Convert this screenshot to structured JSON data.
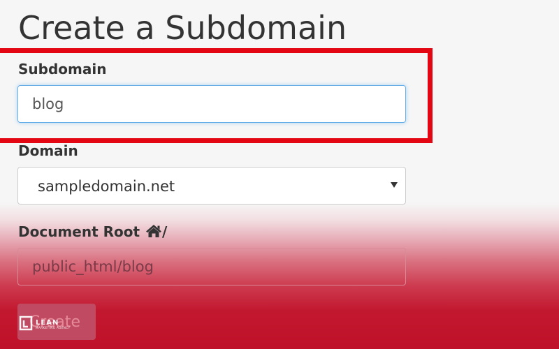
{
  "page": {
    "title": "Create a Subdomain"
  },
  "subdomain": {
    "label": "Subdomain",
    "value": "blog"
  },
  "domain": {
    "label": "Domain",
    "selected": "sampledomain.net"
  },
  "document_root": {
    "label": "Document Root",
    "prefix": "/",
    "value": "public_html/blog"
  },
  "create_button": {
    "label": "Create"
  },
  "watermark": {
    "line1": "LEAN",
    "line2": "MARKETING AGENCY"
  },
  "icons": {
    "home": "home-icon",
    "caret": "caret-down-icon",
    "watermark_logo": "watermark-logo-icon"
  },
  "colors": {
    "highlight": "#e30613",
    "focus_border": "#66afe9",
    "text": "#333333",
    "overlay": "#bf1129"
  }
}
